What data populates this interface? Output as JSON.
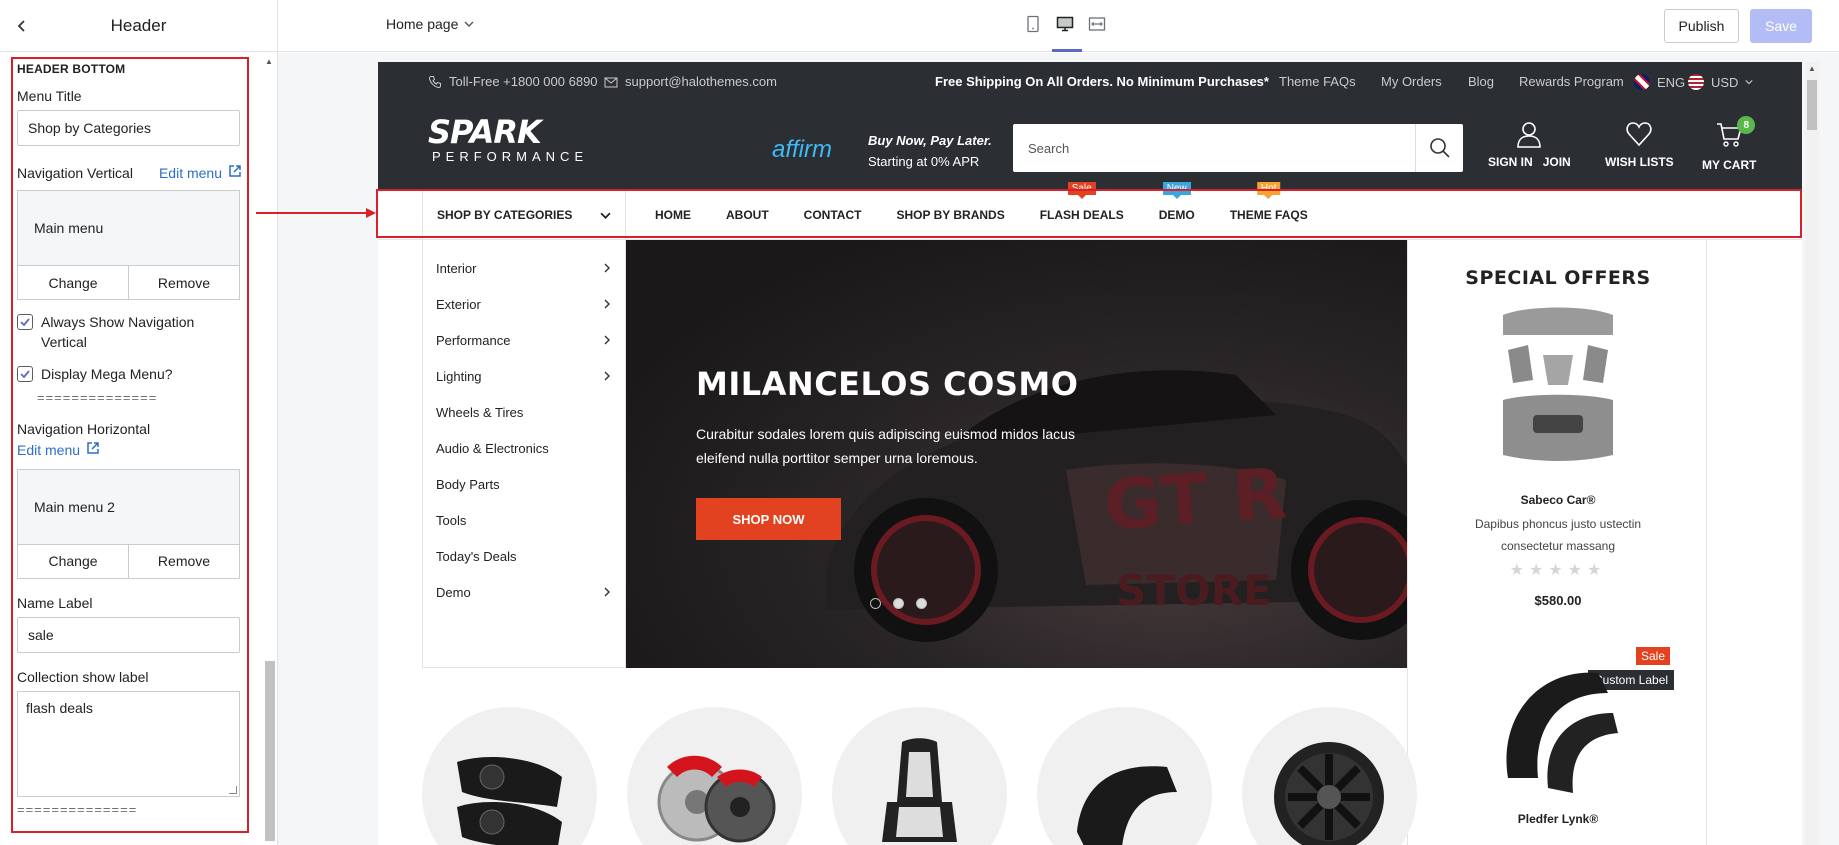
{
  "sidebar": {
    "title": "Header",
    "section_title": "HEADER BOTTOM",
    "menu_title_label": "Menu Title",
    "menu_title_value": "Shop by Categories",
    "nav_vertical_label": "Navigation Vertical",
    "edit_menu": "Edit menu",
    "nav_vertical_menu": "Main menu",
    "change": "Change",
    "remove": "Remove",
    "always_show_label": "Always Show Navigation Vertical",
    "display_mega_label": "Display Mega Menu?",
    "separator": "==============",
    "nav_horizontal_label": "Navigation Horizontal",
    "nav_horizontal_menu": "Main menu 2",
    "name_label_label": "Name Label",
    "name_label_value": "sale",
    "collection_label_label": "Collection show label",
    "collection_label_value": "flash deals"
  },
  "topbar": {
    "page": "Home page",
    "publish": "Publish",
    "save": "Save"
  },
  "store": {
    "phone": "Toll-Free +1800 000 6890",
    "email": "support@halothemes.com",
    "shipping": "Free Shipping On All Orders. No Minimum Purchases*",
    "links": [
      "Theme FAQs",
      "My Orders",
      "Blog",
      "Rewards Program"
    ],
    "lang": "ENG",
    "currency": "USD",
    "logo_main": "SPARK",
    "logo_sub": "PERFORMANCE",
    "affirm": "affirm",
    "bnpl_title": "Buy Now, Pay Later.",
    "bnpl_sub": "Starting at 0% APR",
    "search_placeholder": "Search",
    "sign_in": "SIGN IN",
    "join": "JOIN",
    "wishlist": "WISH LISTS",
    "cart": "MY CART",
    "cart_count": "8",
    "shop_by_categories": "SHOP BY CATEGORIES",
    "nav": [
      {
        "label": "HOME",
        "badge": ""
      },
      {
        "label": "ABOUT",
        "badge": ""
      },
      {
        "label": "CONTACT",
        "badge": ""
      },
      {
        "label": "SHOP BY BRANDS",
        "badge": ""
      },
      {
        "label": "FLASH DEALS",
        "badge": "Sale",
        "badge_color": "#e2421f"
      },
      {
        "label": "DEMO",
        "badge": "New",
        "badge_color": "#3aa6dd"
      },
      {
        "label": "THEME FAQS",
        "badge": "Hot",
        "badge_color": "#f7a233"
      }
    ],
    "categories": [
      "Interior",
      "Exterior",
      "Performance",
      "Lighting",
      "Wheels & Tires",
      "Audio & Electronics",
      "Body Parts",
      "Tools",
      "Today's Deals",
      "Demo"
    ],
    "hero_title": "MILANCELOS COSMO",
    "hero_desc": "Curabitur sodales lorem quis adipiscing euismod midos lacus eleifend nulla porttitor semper urna loremous.",
    "hero_btn": "SHOP NOW",
    "offers_title": "SPECIAL OFFERS",
    "product1_name": "Sabeco Car®",
    "product1_desc": "Dapibus phoncus justo ustectin consectetur massang",
    "product1_stars": "★★★★★",
    "product1_price": "$580.00",
    "sale_badge": "Sale",
    "custom_label": "Custom Label",
    "product2_name": "Pledfer Lynk®"
  },
  "colors": {
    "accent": "#d8202a",
    "store_dark": "#2b2e33",
    "hero_button": "#e2421f",
    "link": "#2c6ecb",
    "save_disabled": "#b3bcf5"
  }
}
